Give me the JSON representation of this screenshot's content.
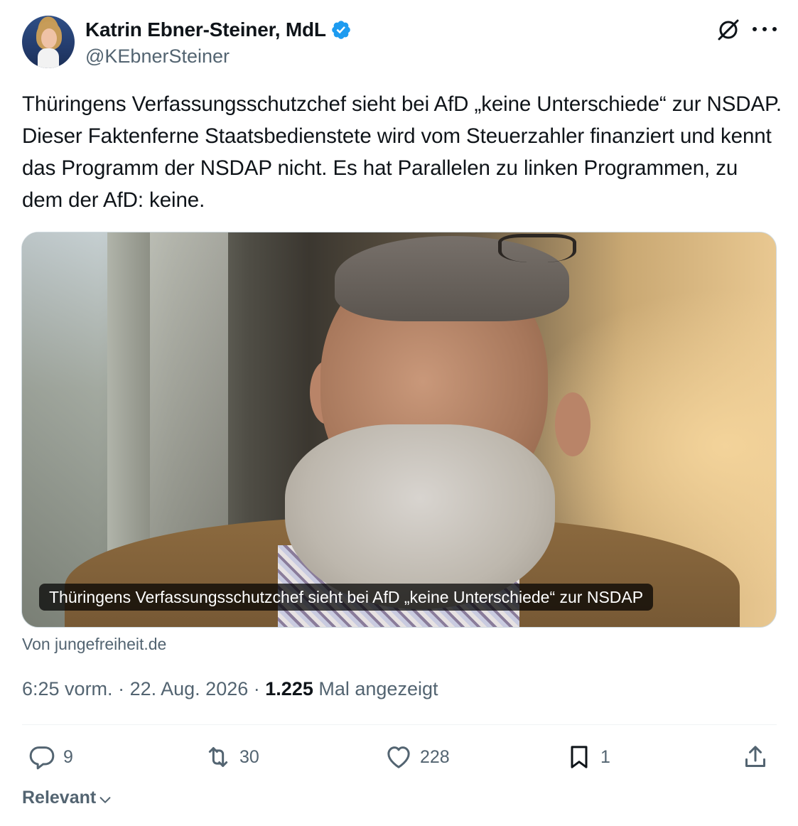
{
  "author": {
    "display_name": "Katrin Ebner-Steiner, MdL",
    "handle": "@KEbnerSteiner",
    "verified": true,
    "avatar_icon": "profile-photo"
  },
  "tweet": {
    "text": "Thüringens Verfassungsschutzchef sieht bei AfD „keine Unterschiede“ zur NSDAP. Dieser Faktenferne Staatsbedienstete wird vom Steuerzahler finanziert und kennt das Programm der NSDAP nicht. Es hat Parallelen zu linken Programmen, zu dem der AfD: keine."
  },
  "link_card": {
    "caption": "Thüringens Verfassungsschutzchef sieht bei AfD „keine Unterschiede“ zur NSDAP",
    "source": "Von jungefreiheit.de"
  },
  "meta": {
    "time": "6:25 vorm.",
    "separator": "·",
    "date": "22. Aug. 2026",
    "views_count": "1.225",
    "views_label": "Mal angezeigt"
  },
  "actions": {
    "replies": "9",
    "retweets": "30",
    "likes": "228",
    "bookmarks": "1"
  },
  "sort": {
    "label": "Relevant"
  },
  "colors": {
    "text": "#0f1419",
    "secondary": "#536471",
    "verified": "#1d9bf0",
    "divider": "#eff3f4"
  }
}
